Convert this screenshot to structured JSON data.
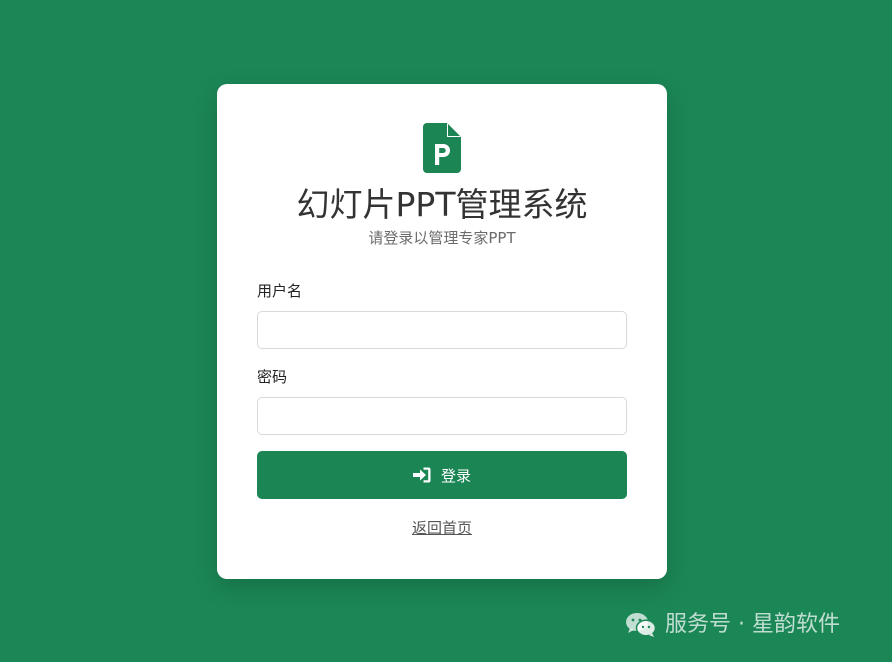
{
  "login": {
    "title": "幻灯片PPT管理系统",
    "subtitle": "请登录以管理专家PPT",
    "username_label": "用户名",
    "username_value": "",
    "password_label": "密码",
    "password_value": "",
    "login_button_label": "登录",
    "login_icon": "sign-in-icon",
    "logo_icon": "ppt-file-icon",
    "back_link_label": "返回首页"
  },
  "watermark": {
    "icon": "wechat-icon",
    "text": "服务号 · 星韵软件"
  },
  "colors": {
    "background": "#1b8756",
    "accent": "#1b8554",
    "card": "#ffffff"
  }
}
